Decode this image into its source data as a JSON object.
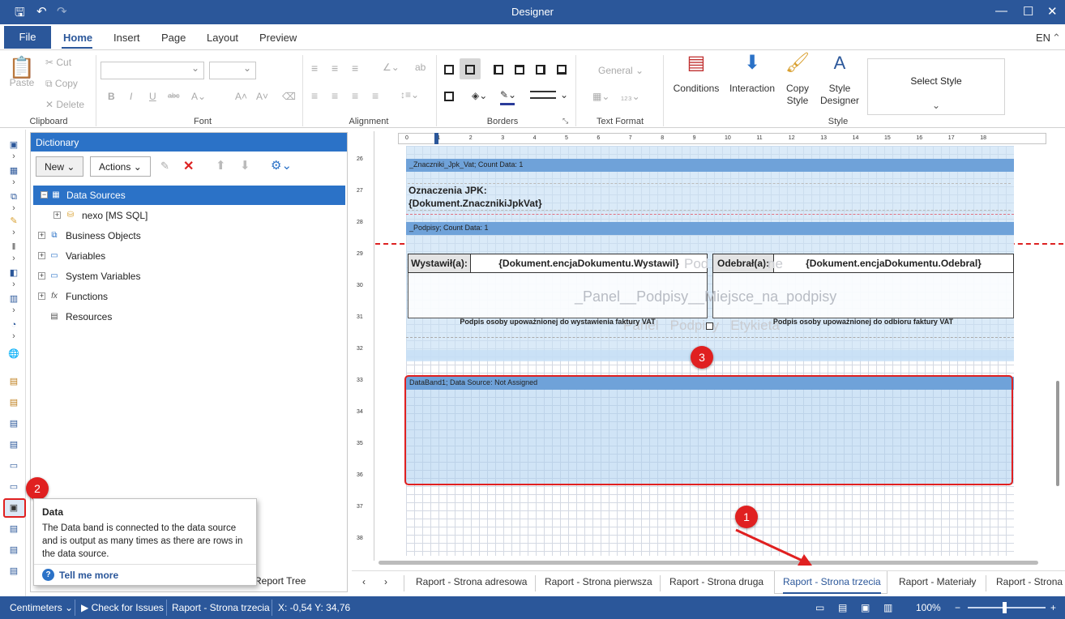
{
  "window": {
    "title": "Designer"
  },
  "menu": {
    "file": "File",
    "tabs": [
      "Home",
      "Insert",
      "Page",
      "Layout",
      "Preview"
    ],
    "lang": "EN"
  },
  "ribbon": {
    "clipboard": {
      "paste": "Paste",
      "cut": "Cut",
      "copy": "Copy",
      "delete": "Delete",
      "label": "Clipboard"
    },
    "font": {
      "label": "Font"
    },
    "alignment": {
      "label": "Alignment"
    },
    "borders": {
      "label": "Borders"
    },
    "text_format": {
      "general": "General",
      "label": "Text Format"
    },
    "style": {
      "conditions": "Conditions",
      "interaction": "Interaction",
      "copy_style_1": "Copy",
      "copy_style_2": "Style",
      "style_designer_1": "Style",
      "style_designer_2": "Designer",
      "select_style": "Select Style",
      "label": "Style"
    }
  },
  "dictionary": {
    "title": "Dictionary",
    "new_btn": "New",
    "actions_btn": "Actions",
    "tree": [
      {
        "label": "Data Sources",
        "sign": "−",
        "selected": true
      },
      {
        "label": "nexo [MS SQL]",
        "sign": "+",
        "child": true
      },
      {
        "label": "Business Objects",
        "sign": "+"
      },
      {
        "label": "Variables",
        "sign": "+"
      },
      {
        "label": "System Variables",
        "sign": "+"
      },
      {
        "label": "Functions",
        "sign": "+"
      },
      {
        "label": "Resources",
        "sign": ""
      }
    ],
    "report_tree_tab": "Report Tree"
  },
  "ruler": {
    "h": [
      "0",
      "1",
      "2",
      "3",
      "4",
      "5",
      "6",
      "7",
      "8",
      "9",
      "10",
      "11",
      "12",
      "13",
      "14",
      "15",
      "16",
      "17",
      "18"
    ],
    "v": [
      "26",
      "27",
      "28",
      "29",
      "30",
      "31",
      "32",
      "33",
      "34",
      "35",
      "36",
      "37",
      "38"
    ]
  },
  "canvas": {
    "band1": "_Znaczniki_Jpk_Vat; Count Data: 1",
    "jpk_line1": "Oznaczenia JPK:",
    "jpk_line2": "{Dokument.ZnacznikiJpkVat}",
    "band2": "_Podpisy; Count Data: 1",
    "wystawil_label": "Wystawił(a):",
    "wystawil_value": "{Dokument.encjaDokumentu.Wystawil}",
    "odebral_label": "Odebrał(a):",
    "odebral_value": "{Dokument.encjaDokumentu.Odebral}",
    "watermark_top_left": "Pod",
    "watermark_top_right": "ne",
    "watermark_center": "_Panel__Podpisy__Miejsce_na_podpisy",
    "watermark_bottom": "Panel   Podpisy   Etykieta",
    "sig_left": "Podpis osoby upoważnionej do wystawienia faktury VAT",
    "sig_right": "Podpis osoby upoważnionej do odbioru faktury VAT",
    "databand": "DataBand1; Data Source: Not Assigned"
  },
  "page_tabs": [
    "Raport - Strona adresowa",
    "Raport - Strona pierwsza",
    "Raport - Strona druga",
    "Raport - Strona trzecia",
    "Raport - Materiały",
    "Raport - Strona"
  ],
  "active_tab": "Raport - Strona trzecia",
  "tooltip": {
    "title": "Data",
    "body": "The Data band is connected to the data source and is output as many times as there are rows in the data source.",
    "link": "Tell me more"
  },
  "status": {
    "units": "Centimeters",
    "check": "Check for Issues",
    "page": "Raport - Strona trzecia",
    "coords": "X: -0,54 Y: 34,76",
    "zoom": "100%"
  },
  "annotations": [
    "1",
    "2",
    "3"
  ],
  "colors": {
    "accent": "#2b579a",
    "band": "#6fa2d9",
    "highlight": "#e02020"
  }
}
